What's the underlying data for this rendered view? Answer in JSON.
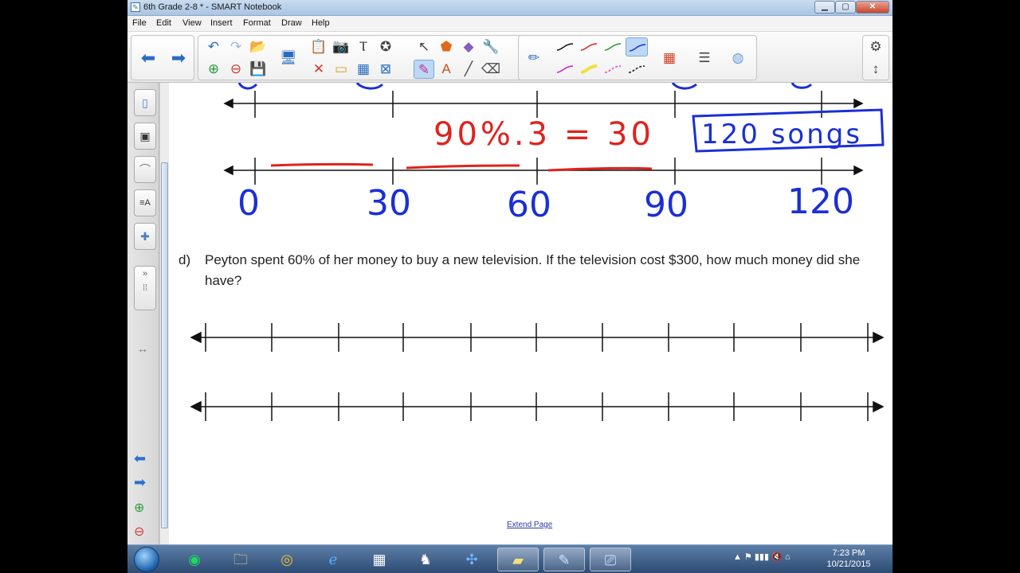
{
  "window": {
    "title": "6th Grade 2-8 * - SMART Notebook",
    "app_icon": "notebook-icon",
    "min_glyph": "▁",
    "max_glyph": "▢",
    "close_glyph": "✕"
  },
  "menu": [
    "File",
    "Edit",
    "View",
    "Insert",
    "Format",
    "Draw",
    "Help"
  ],
  "toolbar": {
    "settings_glyph": "⚙",
    "move_glyph": "↕"
  },
  "canvas": {
    "top_number_line": {
      "annotation": "90%.3 = 30",
      "answer_box": "120 songs",
      "tick_labels": [
        "0",
        "30",
        "60",
        "90",
        "120"
      ]
    },
    "question": {
      "letter": "d)",
      "text": "Peyton spent 60% of her money to buy a new television. If the television cost $300, how much money did she have?"
    },
    "extend_page": "Extend Page"
  },
  "taskbar": {
    "tray_glyphs": "▲  ⚑  ▮▮▮  🔇  ⌂",
    "time": "7:23 PM",
    "date": "10/21/2015"
  },
  "colors": {
    "ink_blue": "#1a2fd6",
    "ink_red": "#e0221c",
    "line_black": "#111111"
  }
}
